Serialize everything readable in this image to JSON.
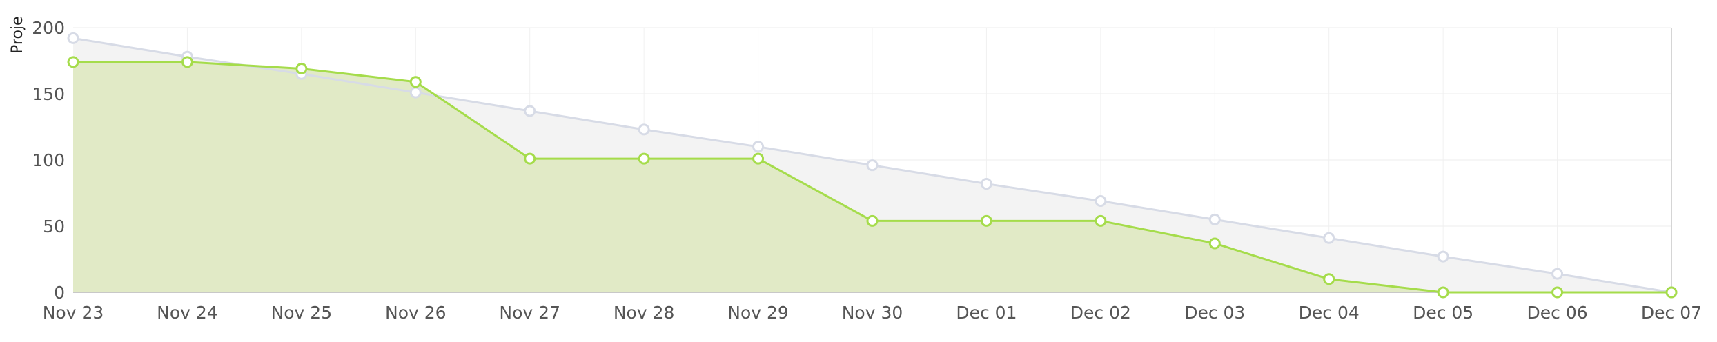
{
  "chart_data": {
    "type": "area",
    "ylabel": "Proje",
    "ylim": [
      0,
      200
    ],
    "yticks": [
      0,
      50,
      100,
      150,
      200
    ],
    "categories": [
      "Nov 23",
      "Nov 24",
      "Nov 25",
      "Nov 26",
      "Nov 27",
      "Nov 28",
      "Nov 29",
      "Nov 30",
      "Dec 01",
      "Dec 02",
      "Dec 03",
      "Dec 04",
      "Dec 05",
      "Dec 06",
      "Dec 07"
    ],
    "grid": true,
    "series": [
      {
        "key": "ideal",
        "values": [
          192,
          178,
          165,
          151,
          137,
          123,
          110,
          96,
          82,
          69,
          55,
          41,
          27,
          14,
          0
        ],
        "line_color": "#d7dbe6",
        "fill_color": "#f3f3f3"
      },
      {
        "key": "actual",
        "values": [
          174,
          174,
          169,
          159,
          101,
          101,
          101,
          54,
          54,
          54,
          37,
          10,
          0,
          0,
          0
        ],
        "line_color": "#a5dc4b",
        "fill_color": "#e1eac6"
      }
    ]
  }
}
